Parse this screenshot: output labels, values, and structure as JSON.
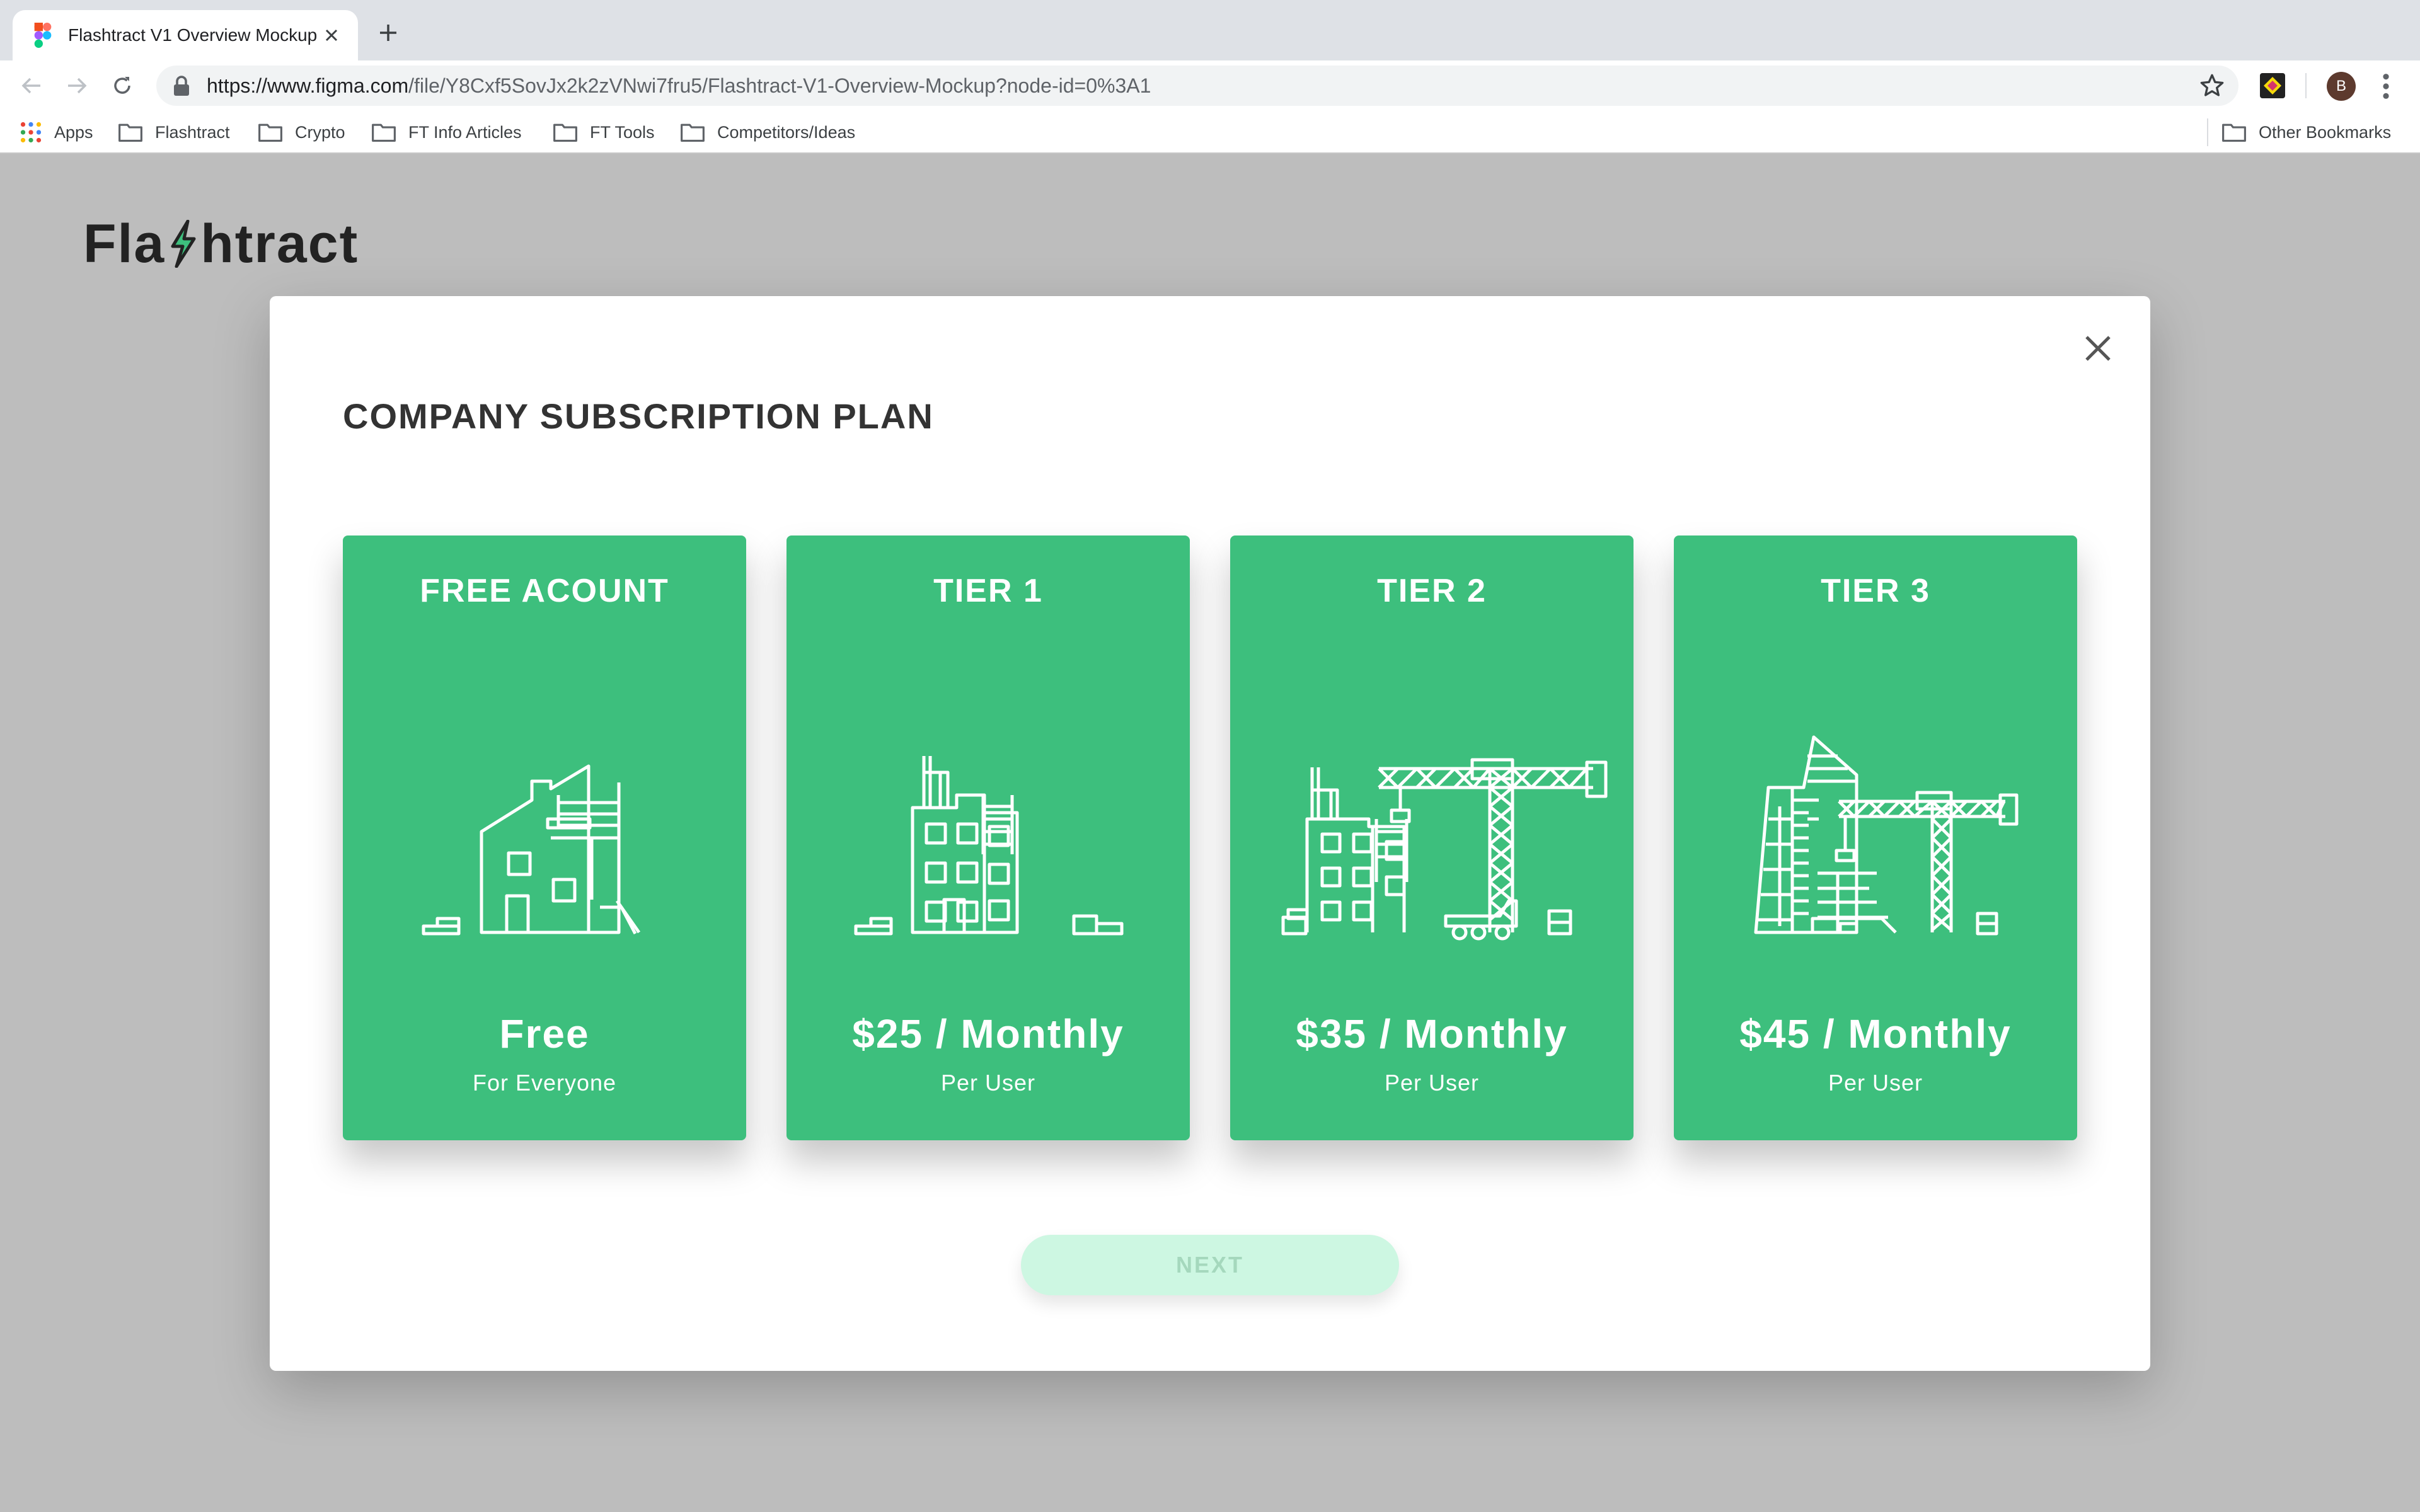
{
  "browser": {
    "tab_title": "Flashtract V1 Overview Mockup",
    "url_host": "https://www.figma.com",
    "url_path": "/file/Y8Cxf5SovJx2k2zVNwi7fru5/Flashtract-V1-Overview-Mockup?node-id=0%3A1",
    "avatar_letter": "B",
    "bookmarks": [
      "Apps",
      "Flashtract",
      "Crypto",
      "FT Info Articles",
      "FT Tools",
      "Competitors/Ideas"
    ],
    "other_bookmarks": "Other Bookmarks"
  },
  "page": {
    "logo_part1": "Fla",
    "logo_part2": "htract",
    "accent_color": "#3dbf7d"
  },
  "modal": {
    "title": "COMPANY SUBSCRIPTION PLAN",
    "plans": [
      {
        "name": "FREE ACOUNT",
        "price": "Free",
        "sub": "For Everyone",
        "icon": "house-under-construction-icon"
      },
      {
        "name": "TIER 1",
        "price": "$25 / Monthly",
        "sub": "Per User",
        "icon": "building-under-construction-icon"
      },
      {
        "name": "TIER 2",
        "price": "$35 / Monthly",
        "sub": "Per User",
        "icon": "building-with-crane-icon"
      },
      {
        "name": "TIER 3",
        "price": "$45 / Monthly",
        "sub": "Per User",
        "icon": "skyscraper-with-crane-icon"
      }
    ],
    "next_label": "NEXT"
  }
}
